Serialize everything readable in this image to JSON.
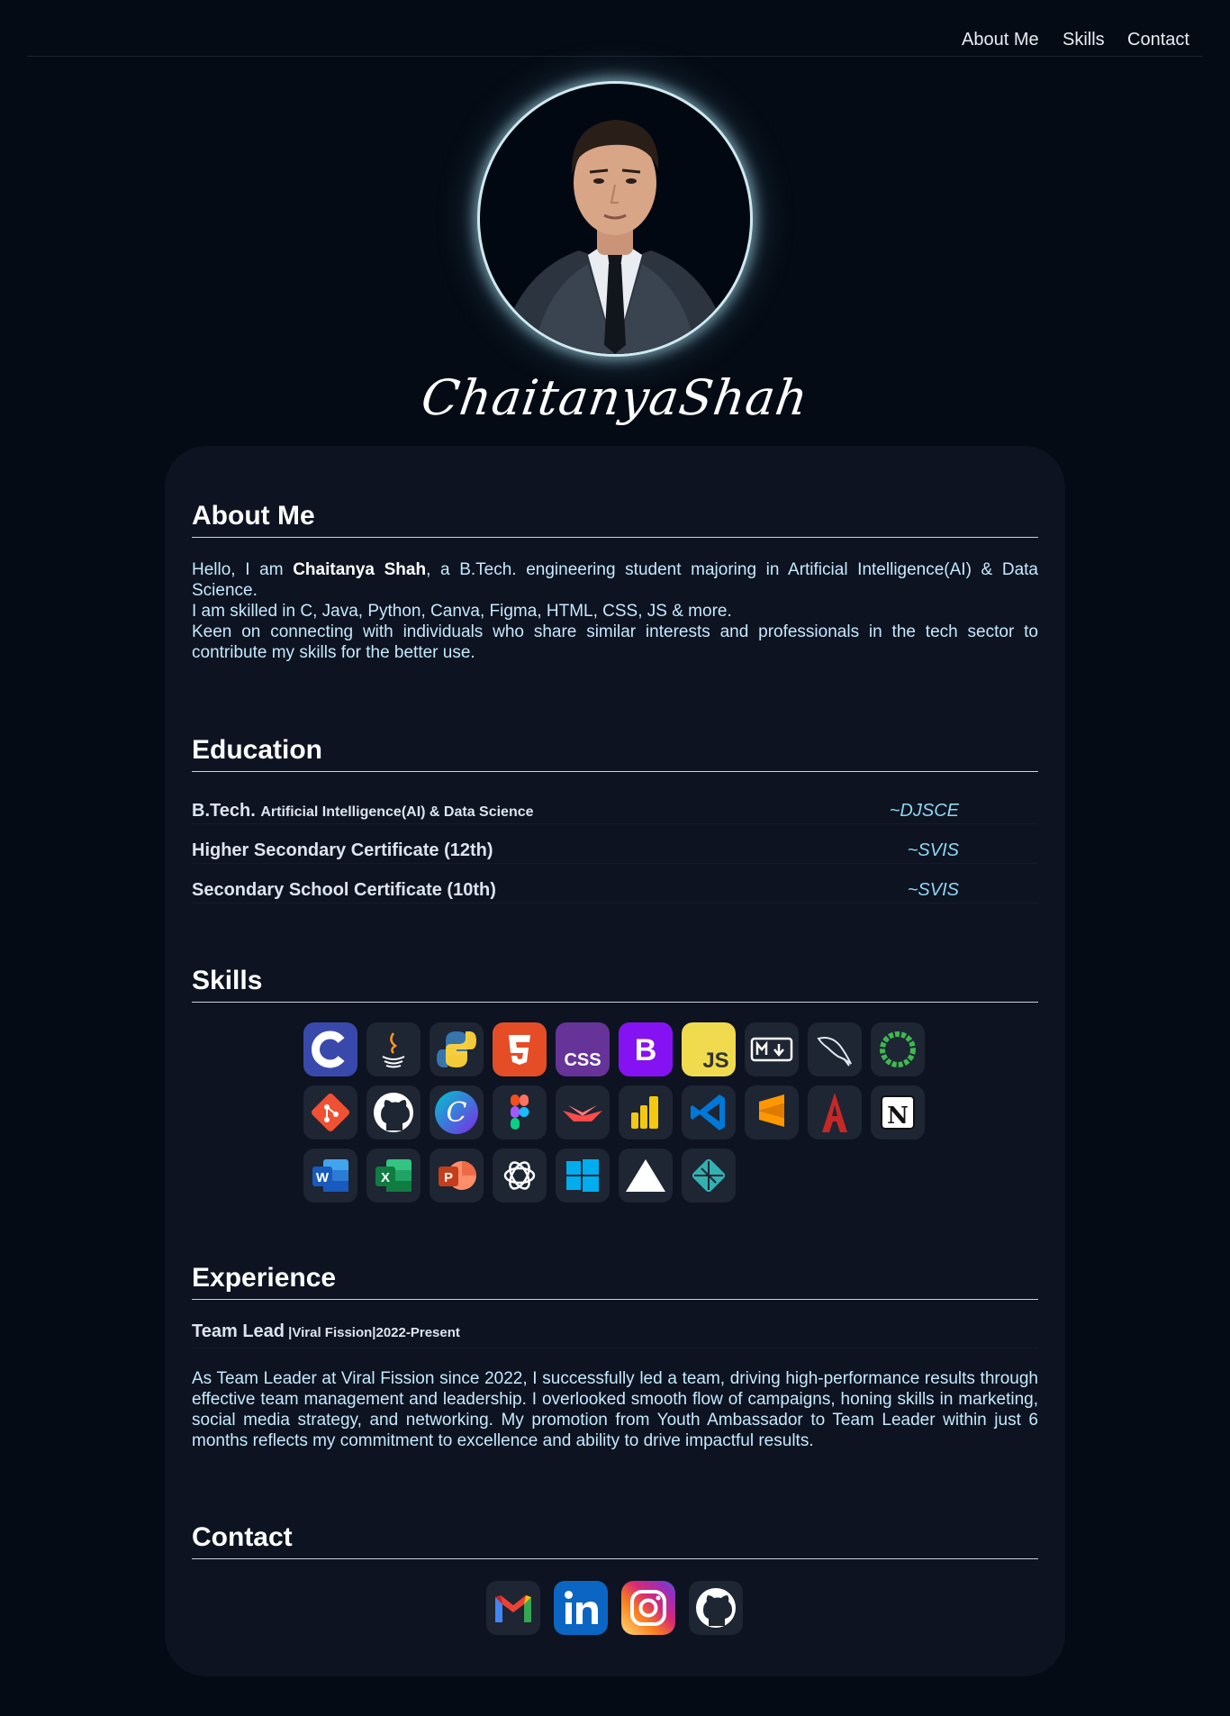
{
  "nav": {
    "items": [
      {
        "label": "About Me"
      },
      {
        "label": "Skills"
      },
      {
        "label": "Contact"
      }
    ]
  },
  "hero": {
    "signature": "ChaitanyaShah"
  },
  "about": {
    "title": "About Me",
    "line1_prefix": "Hello, I am ",
    "name": "Chaitanya Shah",
    "line1_suffix": ", a B.Tech. engineering student majoring in Artificial Intelligence(AI) & Data Science.",
    "line2": "I am skilled in C, Java, Python, Canva, Figma, HTML, CSS, JS & more.",
    "line3": "Keen on connecting with individuals who share similar interests and professionals in the tech sector to contribute my skills for the better use."
  },
  "education": {
    "title": "Education",
    "rows": [
      {
        "degree": "B.Tech.",
        "sub": "Artificial Intelligence(AI) & Data Science",
        "institution": "~DJSCE"
      },
      {
        "degree": "Higher Secondary Certificate (12th)",
        "sub": "",
        "institution": "~SVIS"
      },
      {
        "degree": "Secondary School Certificate (10th)",
        "sub": "",
        "institution": "~SVIS"
      }
    ]
  },
  "skills": {
    "title": "Skills",
    "icons": [
      "c-icon",
      "java-icon",
      "python-icon",
      "html5-icon",
      "css-icon",
      "bootstrap-icon",
      "javascript-icon",
      "markdown-icon",
      "mysql-icon",
      "circle-ring-icon",
      "git-icon",
      "github-icon",
      "canva-icon",
      "figma-icon",
      "streamlit-icon",
      "powerbi-icon",
      "vscode-icon",
      "sublime-icon",
      "acrobat-icon",
      "notion-icon",
      "word-icon",
      "excel-icon",
      "powerpoint-icon",
      "chatgpt-icon",
      "windows-icon",
      "vercel-icon",
      "netlify-icon"
    ]
  },
  "experience": {
    "title": "Experience",
    "role": "Team Lead",
    "meta": " |Viral Fission|2022-Present",
    "description": "As Team Leader at Viral Fission since 2022, I successfully led a team, driving high-performance results through effective team management and leadership. I overlooked smooth flow of campaigns, honing skills in marketing, social media strategy, and networking. My promotion from Youth Ambassador to Team Leader within just 6 months reflects my commitment to excellence and ability to drive impactful results."
  },
  "contact": {
    "title": "Contact",
    "icons": [
      "gmail-icon",
      "linkedin-icon",
      "instagram-icon",
      "github-icon"
    ]
  },
  "colors": {
    "background": "#050b14",
    "card": "#0d1320",
    "accent_text": "#c5e9ff",
    "institution": "#8fd7f5"
  }
}
